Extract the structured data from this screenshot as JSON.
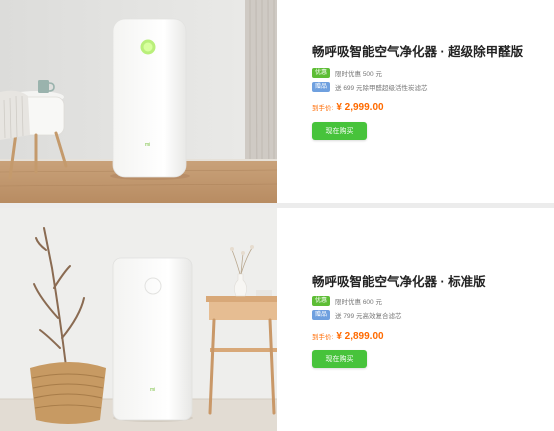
{
  "products": [
    {
      "title": "畅呼吸智能空气净化器 · 超级除甲醛版",
      "promos": [
        {
          "tag": "优惠",
          "text": "限时优惠 500 元",
          "tag_color": "#5dbd35"
        },
        {
          "tag": "赠品",
          "text": "送 699 元除甲醛超级活性炭滤芯",
          "tag_color": "#6fa0df"
        }
      ],
      "price_label": "到手价:",
      "price": "¥ 2,999.00",
      "buy_label": "现在购买"
    },
    {
      "title": "畅呼吸智能空气净化器 · 标准版",
      "promos": [
        {
          "tag": "优惠",
          "text": "限时优惠 600 元",
          "tag_color": "#5dbd35"
        },
        {
          "tag": "赠品",
          "text": "送 799 元高效复合滤芯",
          "tag_color": "#6fa0df"
        }
      ],
      "price_label": "到手价:",
      "price": "¥ 2,899.00",
      "buy_label": "现在购买"
    }
  ],
  "colors": {
    "accent_green": "#47c33b",
    "price_orange": "#ff6a00"
  }
}
